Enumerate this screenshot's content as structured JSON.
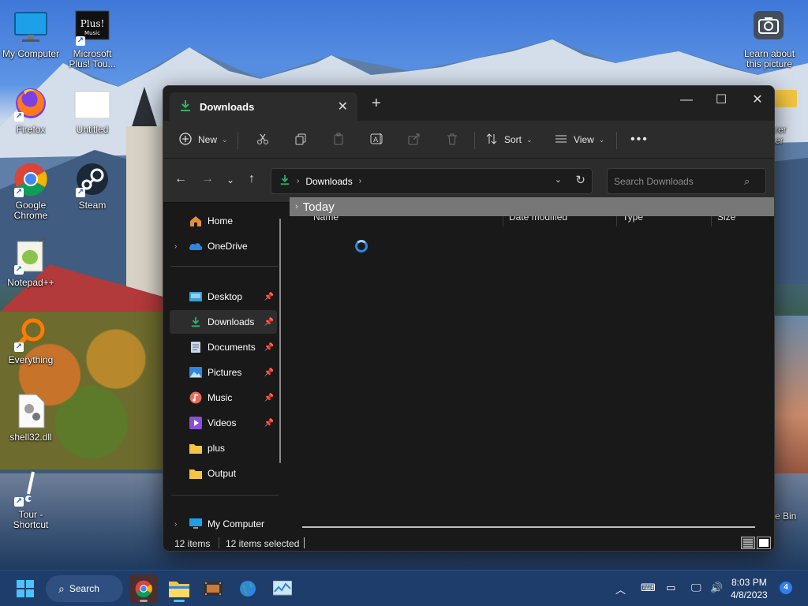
{
  "desktop": {
    "icons": [
      {
        "label": "My Computer",
        "icon": "monitor-icon"
      },
      {
        "label": "Microsoft Plus! Tou...",
        "icon": "plus-music-icon",
        "badge": "Plus! Music"
      },
      {
        "label": "Firefox",
        "icon": "firefox-icon"
      },
      {
        "label": "Untitled",
        "icon": "blank-document-icon"
      },
      {
        "label": "Google Chrome",
        "icon": "chrome-icon"
      },
      {
        "label": "Steam",
        "icon": "steam-icon"
      },
      {
        "label": "Notepad++",
        "icon": "notepadpp-icon"
      },
      {
        "label": "Everything",
        "icon": "everything-search-icon"
      },
      {
        "label": "shell32.dll",
        "icon": "dll-file-icon"
      },
      {
        "label": "Tour - Shortcut",
        "icon": "tour-shortcut-icon"
      },
      {
        "label": "Learn about this picture",
        "icon": "camera-icon"
      }
    ],
    "partial_labels": [
      "rer",
      "er",
      "e Bin"
    ]
  },
  "explorer": {
    "tab_title": "Downloads",
    "toolbar": {
      "new_label": "New",
      "sort_label": "Sort",
      "view_label": "View"
    },
    "address": {
      "segment": "Downloads"
    },
    "search_placeholder": "Search Downloads",
    "nav_items": {
      "home": "Home",
      "onedrive": "OneDrive",
      "desktop": "Desktop",
      "downloads": "Downloads",
      "documents": "Documents",
      "pictures": "Pictures",
      "music": "Music",
      "videos": "Videos",
      "plus": "plus",
      "output": "Output",
      "mycomputer": "My Computer"
    },
    "columns": {
      "name": "Name",
      "date": "Date modified",
      "type": "Type",
      "size": "Size"
    },
    "group_label": "Today",
    "status": {
      "items": "12 items",
      "selected": "12 items selected"
    }
  },
  "taskbar": {
    "search_label": "Search",
    "time": "8:03 PM",
    "date": "4/8/2023",
    "notifications": "4"
  },
  "colors": {
    "window_bg": "#191919",
    "toolbar_bg": "#2c2c2c",
    "accent": "#2f86e0",
    "downloads_green": "#2fb36b",
    "folder_yellow": "#f4c542",
    "taskbar_bg": "#1f3d6a"
  }
}
